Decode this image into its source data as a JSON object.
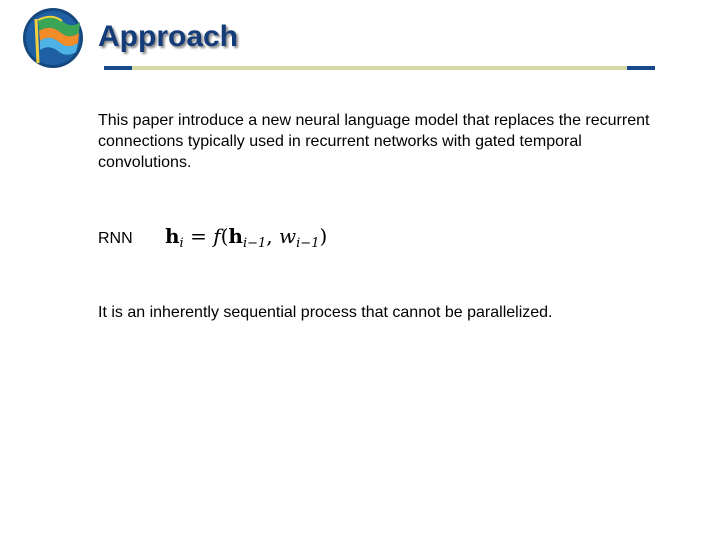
{
  "slide": {
    "title": "Approach",
    "intro": "This paper introduce a new neural language model that replaces the recurrent connections typically used in recurrent networks with gated temporal convolutions.",
    "rnn_label": "RNN",
    "formula": {
      "lhs": "h",
      "lhs_sub": "i",
      "equals": "=",
      "func": "f",
      "open": "(",
      "arg1": "h",
      "arg1_sub": "i−1",
      "comma": ",",
      "arg2": "w",
      "arg2_sub": "i−1",
      "close": ")"
    },
    "conclusion": "It is an inherently sequential process that cannot be parallelized."
  },
  "colors": {
    "title": "#143c78",
    "rule": "#d4d9a6",
    "rule_caps": "#174a8c"
  },
  "logo": {
    "icon": "flag-globe-logo"
  }
}
